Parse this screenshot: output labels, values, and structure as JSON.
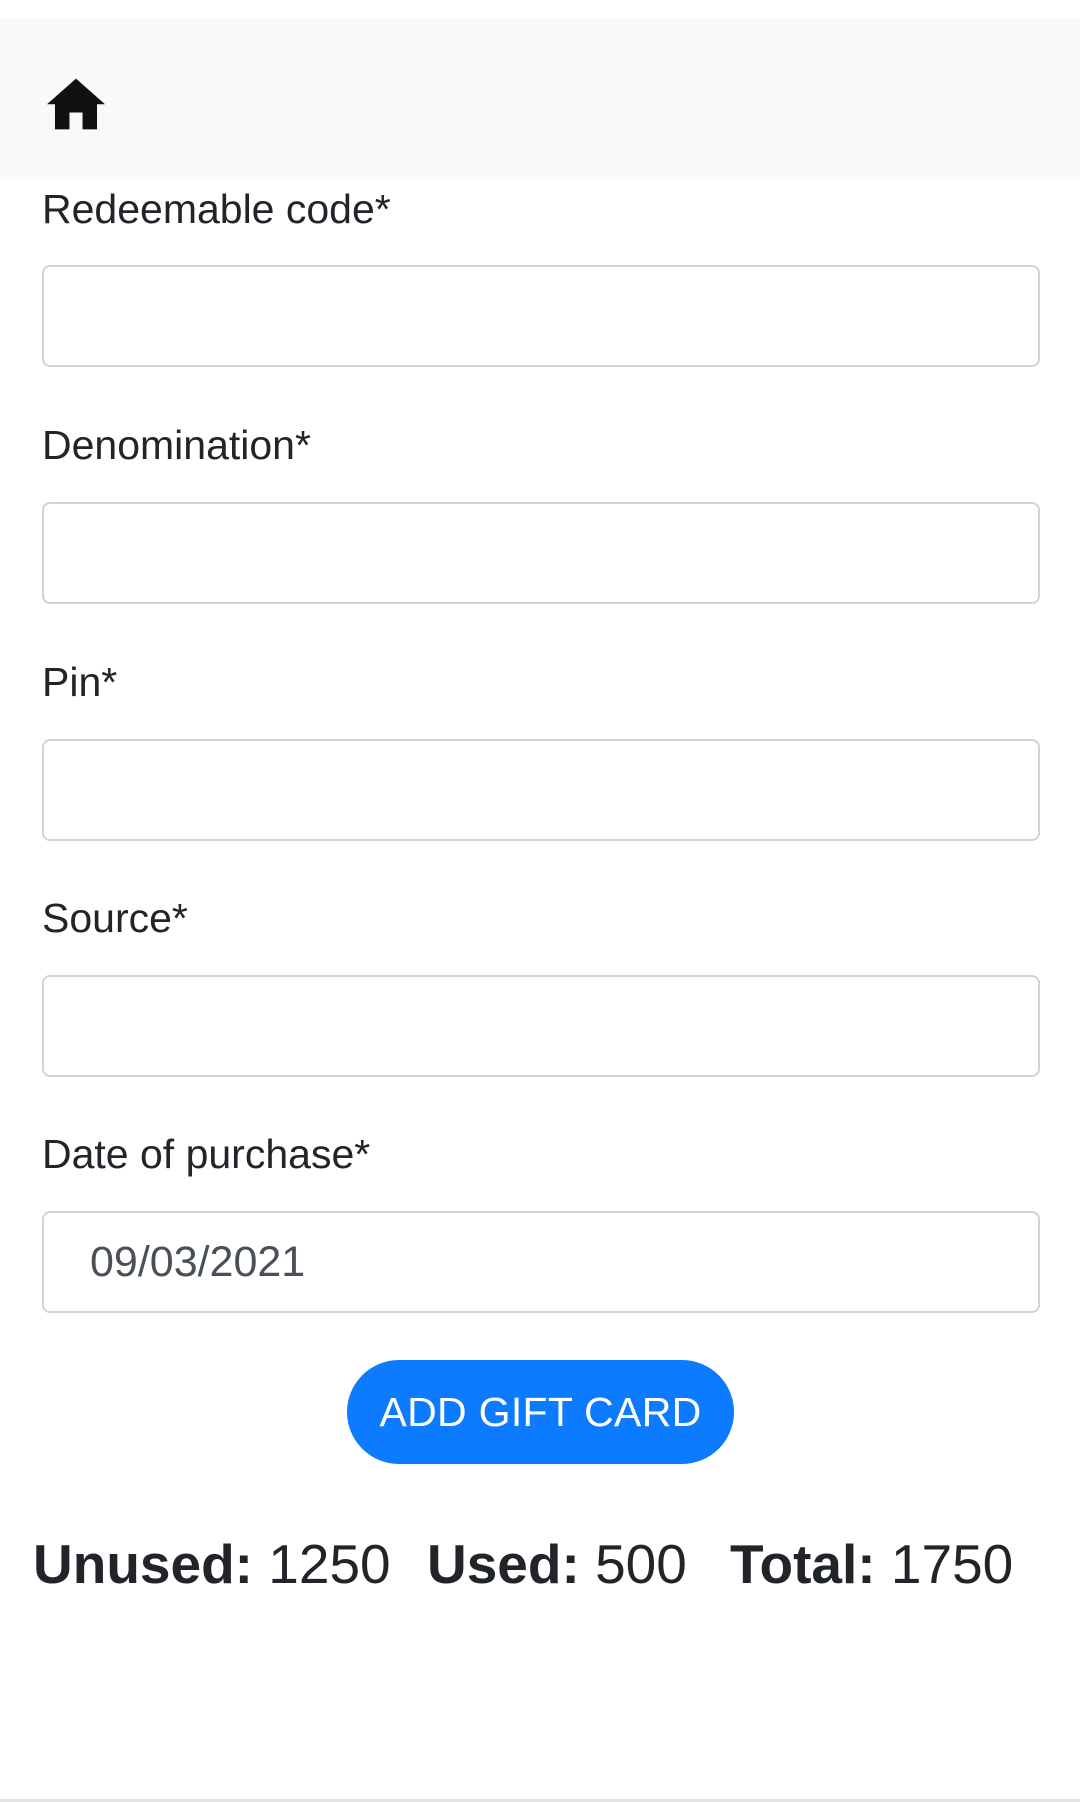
{
  "header": {
    "home_icon": "home-icon"
  },
  "form": {
    "redeemable_code": {
      "label": "Redeemable code*",
      "value": ""
    },
    "denomination": {
      "label": "Denomination*",
      "value": ""
    },
    "pin": {
      "label": "Pin*",
      "value": ""
    },
    "source": {
      "label": "Source*",
      "value": ""
    },
    "date_of_purchase": {
      "label": "Date of purchase*",
      "value": "09/03/2021"
    },
    "submit_label": "ADD GIFT CARD"
  },
  "summary": {
    "unused_label": "Unused:",
    "unused_value": "1250",
    "used_label": "Used:",
    "used_value": "500",
    "total_label": "Total:",
    "total_value": "1750"
  },
  "colors": {
    "accent": "#0d7bff",
    "header_bg": "#f8f9fa",
    "input_border": "#ced4da",
    "text": "#212529"
  }
}
